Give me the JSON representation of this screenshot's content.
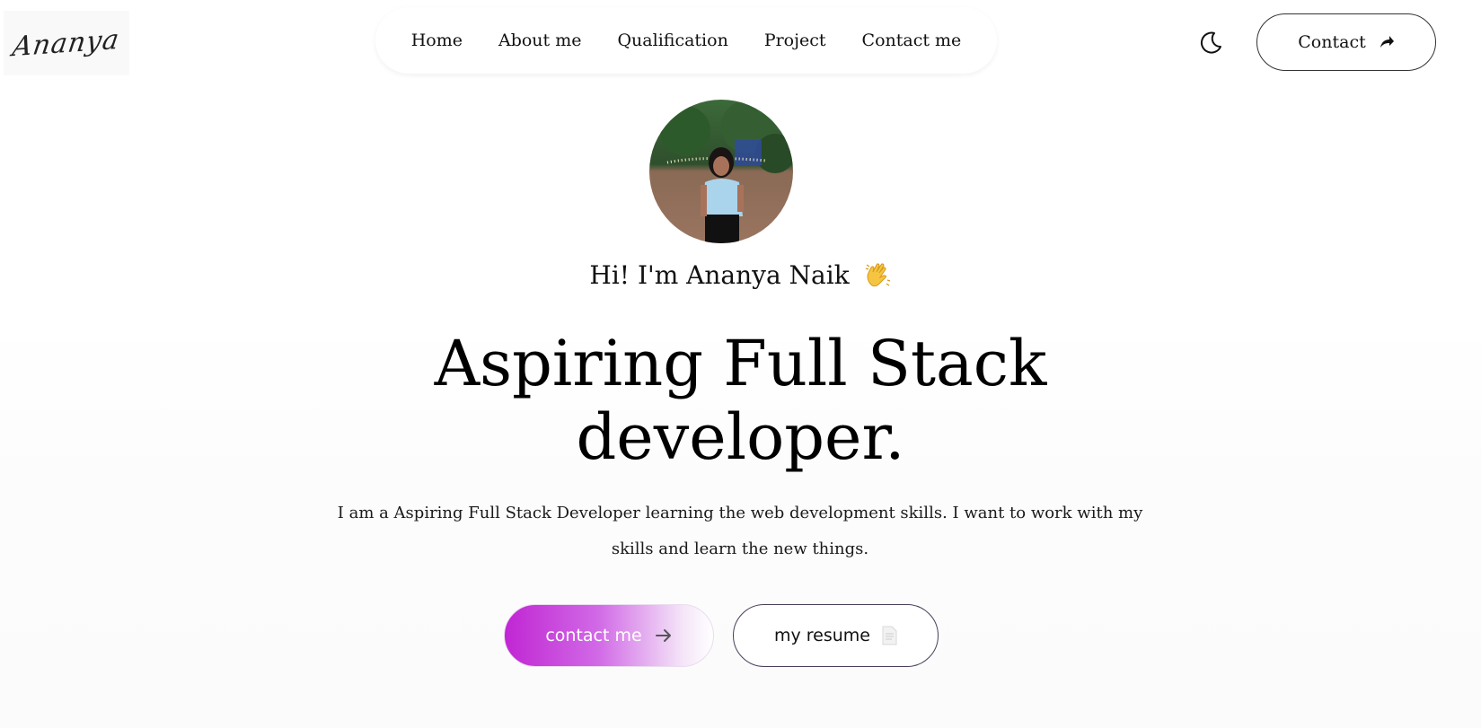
{
  "header": {
    "logo_text": "Ananya",
    "nav": [
      {
        "label": "Home"
      },
      {
        "label": "About me"
      },
      {
        "label": "Qualification"
      },
      {
        "label": "Project"
      },
      {
        "label": "Contact me"
      }
    ],
    "theme_icon": "moon-icon",
    "contact_label": "Contact",
    "contact_icon": "arrow-up-right-icon"
  },
  "hero": {
    "greeting": "Hi! I'm Ananya Naik",
    "greeting_icon": "waving-hand-icon",
    "headline_line1": "Aspiring Full Stack",
    "headline_line2": "developer.",
    "description": "I am a Aspiring Full Stack Developer learning the web development skills. I want to work with my skills and learn the new things.",
    "primary_button": {
      "label": "contact me",
      "icon": "arrow-right-icon"
    },
    "secondary_button": {
      "label": "my resume",
      "icon": "document-icon"
    }
  },
  "colors": {
    "accent": "#c026d3",
    "text": "#111111",
    "background": "#ffffff"
  }
}
